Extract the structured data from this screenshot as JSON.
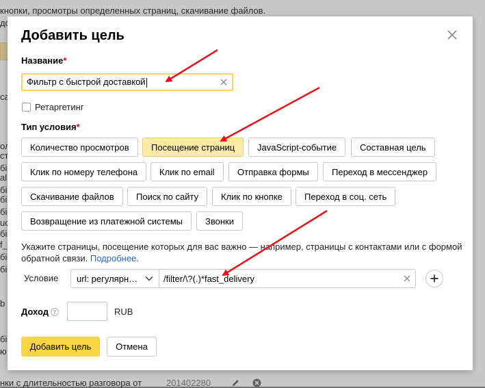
{
  "background": {
    "top_text": "кнопки, просмотры определенных страниц, скачивание файлов.",
    "bottom_text": "нки с длительностью разговора от",
    "bottom_id": "201402280",
    "side_fragments": [
      "до",
      "са",
      "ол",
      "ст",
      "бі",
      "all",
      "бі",
      "бі",
      "бі",
      "uc",
      "бі",
      "f_",
      "бі",
      "бі",
      "b",
      "бі",
      "ю"
    ]
  },
  "modal": {
    "title": "Добавить цель",
    "name_label": "Название",
    "name_value": "Фильтр с быстрой доставкой",
    "retargeting_label": "Ретаргетинг",
    "condition_type_label": "Тип условия",
    "required_mark": "*",
    "options": [
      {
        "label": "Количество просмотров",
        "selected": false
      },
      {
        "label": "Посещение страниц",
        "selected": true
      },
      {
        "label": "JavaScript-событие",
        "selected": false
      },
      {
        "label": "Составная цель",
        "selected": false
      },
      {
        "label": "Клик по номеру телефона",
        "selected": false
      },
      {
        "label": "Клик по email",
        "selected": false
      },
      {
        "label": "Отправка формы",
        "selected": false
      },
      {
        "label": "Переход в мессенджер",
        "selected": false
      },
      {
        "label": "Скачивание файлов",
        "selected": false
      },
      {
        "label": "Поиск по сайту",
        "selected": false
      },
      {
        "label": "Клик по кнопке",
        "selected": false
      },
      {
        "label": "Переход в соц. сеть",
        "selected": false
      },
      {
        "label": "Возвращение из платежной системы",
        "selected": false
      },
      {
        "label": "Звонки",
        "selected": false
      }
    ],
    "hint_text": "Укажите страницы, посещение которых для вас важно — например, страницы с контактами или с формой обратной связи.",
    "hint_link": "Подробнее",
    "hint_end": ".",
    "condition_label": "Условие",
    "condition_select_value": "url: регулярн…",
    "condition_input_value": "/filter/\\?(.)*fast_delivery",
    "income_label": "Доход",
    "currency": "RUB",
    "submit_label": "Добавить цель",
    "cancel_label": "Отмена"
  },
  "colors": {
    "accent_yellow": "#f8d643",
    "selected_option": "#fdeba8",
    "input_focus": "#f5d55c",
    "required": "#e0001a",
    "link": "#2a66c9",
    "arrow": "#e8141b"
  }
}
